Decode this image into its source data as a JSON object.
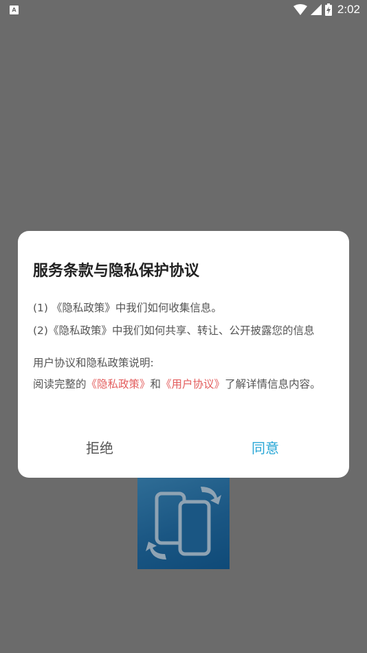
{
  "status_bar": {
    "app_icon_letter": "A",
    "time": "2:02",
    "icons": [
      "wifi-icon",
      "signal-icon",
      "battery-charging-icon"
    ]
  },
  "dialog": {
    "title": "服务条款与隐私保护协议",
    "line1": "(1) 《隐私政策》中我们如何收集信息。",
    "line2": "(2)《隐私政策》中我们如何共享、转让、公开披露您的信息",
    "line3": "用户协议和隐私政策说明:",
    "line4_prefix": "阅读完整的",
    "privacy_link": "《隐私政策》",
    "line4_and": "和",
    "agreement_link": "《用户协议》",
    "line4_suffix": "了解详情信息内容。",
    "reject_label": "拒绝",
    "agree_label": "同意"
  },
  "colors": {
    "overlay": "#6b6b6b",
    "link": "#e35d5d",
    "agree": "#27a6d6",
    "logo_bg": "#1a5683"
  }
}
